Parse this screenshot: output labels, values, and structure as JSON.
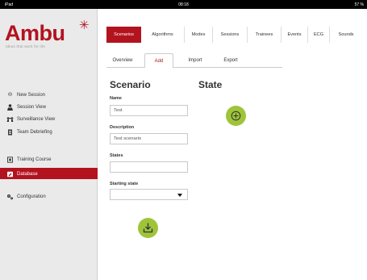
{
  "status_bar": {
    "device": "iPad",
    "time": "08:18",
    "battery": "57 %"
  },
  "logo": {
    "wordmark": "Ambu",
    "tagline": "Ideas that work for life"
  },
  "sidebar": {
    "items": [
      {
        "label": "New Session",
        "icon": "new-session-icon",
        "active": false
      },
      {
        "label": "Session View",
        "icon": "person-icon",
        "active": false
      },
      {
        "label": "Surveillance View",
        "icon": "surveillance-icon",
        "active": false
      },
      {
        "label": "Team Debriefing",
        "icon": "clipboard-icon",
        "active": false
      },
      {
        "label": "Training Course",
        "icon": "training-icon",
        "active": false
      },
      {
        "label": "Database",
        "icon": "database-icon",
        "active": true
      },
      {
        "label": "Configuration",
        "icon": "configuration-icon",
        "active": false
      }
    ]
  },
  "top_tabs": [
    {
      "label": "Scenarios",
      "active": true
    },
    {
      "label": "Algorithms",
      "active": false
    },
    {
      "label": "Modes",
      "active": false
    },
    {
      "label": "Sessions",
      "active": false
    },
    {
      "label": "Trainees",
      "active": false
    },
    {
      "label": "Events",
      "active": false
    },
    {
      "label": "ECG",
      "active": false
    },
    {
      "label": "Sounds",
      "active": false
    }
  ],
  "sub_tabs": [
    {
      "label": "Overview",
      "active": false
    },
    {
      "label": "Add",
      "active": true
    },
    {
      "label": "Import",
      "active": false
    },
    {
      "label": "Export",
      "active": false
    }
  ],
  "form": {
    "title": "Scenario",
    "name_label": "Name",
    "name_value": "Test",
    "description_label": "Description",
    "description_value": "Test scenario",
    "states_label": "States",
    "states_value": "",
    "starting_state_label": "Starting state",
    "starting_state_value": ""
  },
  "state_panel": {
    "title": "State"
  },
  "colors": {
    "brand": "#b3121f",
    "accent_green": "#9fc43a",
    "sidebar_bg": "#eaeaea"
  }
}
